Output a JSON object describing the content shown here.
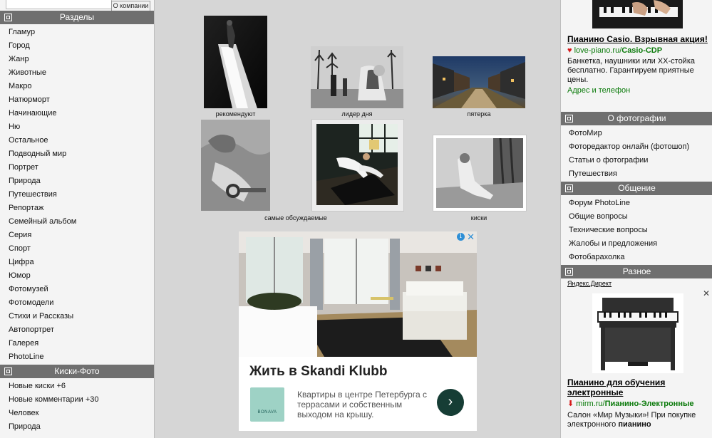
{
  "left_sidebar": {
    "about_button": "О компании",
    "sections_title": "Разделы",
    "sections": [
      "Гламур",
      "Город",
      "Жанр",
      "Животные",
      "Макро",
      "Натюрморт",
      "Начинающие",
      "Ню",
      "Остальное",
      "Подводный мир",
      "Портрет",
      "Природа",
      "Путешествия",
      "Репортаж",
      "Семейный альбом",
      "Серия",
      "Спорт",
      "Цифра",
      "Юмор",
      "Фотомузей",
      "Фотомодели",
      "Стихи и Рассказы",
      "Автопортрет",
      "Галерея",
      "PhotoLine"
    ],
    "kiski_title": "Киски-Фото",
    "kiski": [
      "Новые киски +6",
      "Новые комментарии +30",
      "Человек",
      "Природа"
    ]
  },
  "gallery": {
    "captions": [
      "рекомендуют",
      "лидер дня",
      "пятерка",
      "самые обсуждаемые",
      "киски"
    ]
  },
  "center_ad": {
    "title": "Жить в Skandi Klubb",
    "text": "Квартиры в центре Петербурга с террасами и собственным выходом на крышу.",
    "logo_text": "BONAVA",
    "info_icon": "i",
    "close_icon": "✕"
  },
  "right_sidebar": {
    "top_ad": {
      "title": "Пианино Casio. Взрывная акция!",
      "url_prefix": "love-piano.ru/",
      "url_bold": "Casio-CDP",
      "body": "Банкетка, наушники или XX-стойка бесплатно. Гарантируем приятные цены.",
      "link": "Адрес и телефон"
    },
    "about_photo_title": "О фотографии",
    "about_photo": [
      "ФотоМир",
      "Фоторедактор онлайн (фотошоп)",
      "Статьи о фотографии",
      "Путешествия"
    ],
    "social_title": "Общение",
    "social": [
      "Форум PhotoLine",
      "Общие вопросы",
      "Технические вопросы",
      "Жалобы и предложения",
      "Фотобарахолка"
    ],
    "misc_title": "Разное",
    "yandex_label": "Яндекс.Директ",
    "bottom_ad": {
      "title": "Пианино для обучения электронные",
      "url_prefix": "mirm.ru/",
      "url_bold": "Пианино-Электронные",
      "body_start": "Салон «Мир Музыки»! При покупке электронного ",
      "body_bold": "пианино"
    }
  },
  "colors": {
    "header_gray": "#6f6f6f",
    "link_green": "#0a7a0a",
    "ad_blue": "#2e8fd6",
    "ad_dark_button": "#163d35"
  }
}
